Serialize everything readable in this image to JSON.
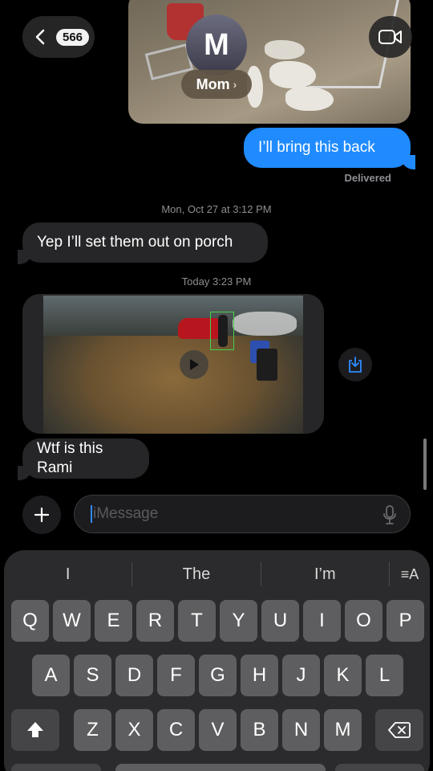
{
  "header": {
    "back_count": "566",
    "contact_initial": "M",
    "contact_name": "Mom",
    "icons": {
      "back": "chevron-left-icon",
      "video": "video-camera-icon",
      "name_chevron": "chevron-right-icon"
    }
  },
  "messages": {
    "sent_1": "I’ll bring this back",
    "delivered": "Delivered",
    "timestamp_1": "Mon, Oct 27 at 3:12 PM",
    "recv_1": "Yep I’ll set them out on porch",
    "timestamp_2": "Today 3:23 PM",
    "recv_2": "Wtf is this Rami"
  },
  "composer": {
    "placeholder": "iMessage",
    "icons": {
      "plus": "plus-icon",
      "mic": "microphone-icon",
      "save": "save-download-icon",
      "play": "play-icon"
    }
  },
  "keyboard": {
    "suggestions": [
      "I",
      "The",
      "I’m"
    ],
    "format_icon": "≡A",
    "row1": [
      "Q",
      "W",
      "E",
      "R",
      "T",
      "Y",
      "U",
      "I",
      "O",
      "P"
    ],
    "row2": [
      "A",
      "S",
      "D",
      "F",
      "G",
      "H",
      "J",
      "K",
      "L"
    ],
    "row3": [
      "Z",
      "X",
      "C",
      "V",
      "B",
      "N",
      "M"
    ],
    "icons": {
      "shift": "shift-arrow-icon",
      "delete": "backspace-icon"
    }
  },
  "colors": {
    "sent_bubble": "#1f8bff",
    "recv_bubble": "#262628",
    "background": "#000000"
  }
}
